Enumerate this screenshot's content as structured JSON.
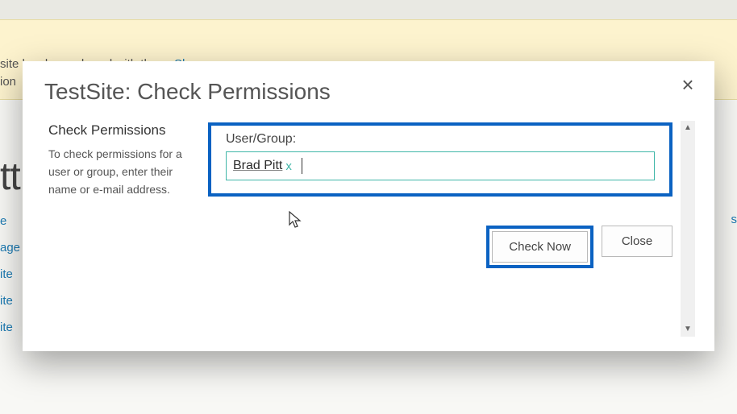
{
  "background": {
    "notice_prefix": "site has been shared with them.",
    "notice_link": "Show users",
    "notice_line2_suffix": "ion",
    "left_title_fragment": "tt",
    "left_links": [
      "e",
      "age",
      "ite",
      "ite",
      "ite"
    ],
    "right_char": "s"
  },
  "dialog": {
    "title": "TestSite: Check Permissions",
    "close_icon": "×",
    "section_heading": "Check Permissions",
    "section_text": "To check permissions for a user or group, enter their name or e-mail address.",
    "user_group_label": "User/Group:",
    "selected_person": "Brad Pitt",
    "chip_remove": "x",
    "check_now_label": "Check Now",
    "close_label": "Close"
  },
  "scroll": {
    "up": "▲",
    "down": "▼"
  },
  "highlight_color": "#0b62c2"
}
